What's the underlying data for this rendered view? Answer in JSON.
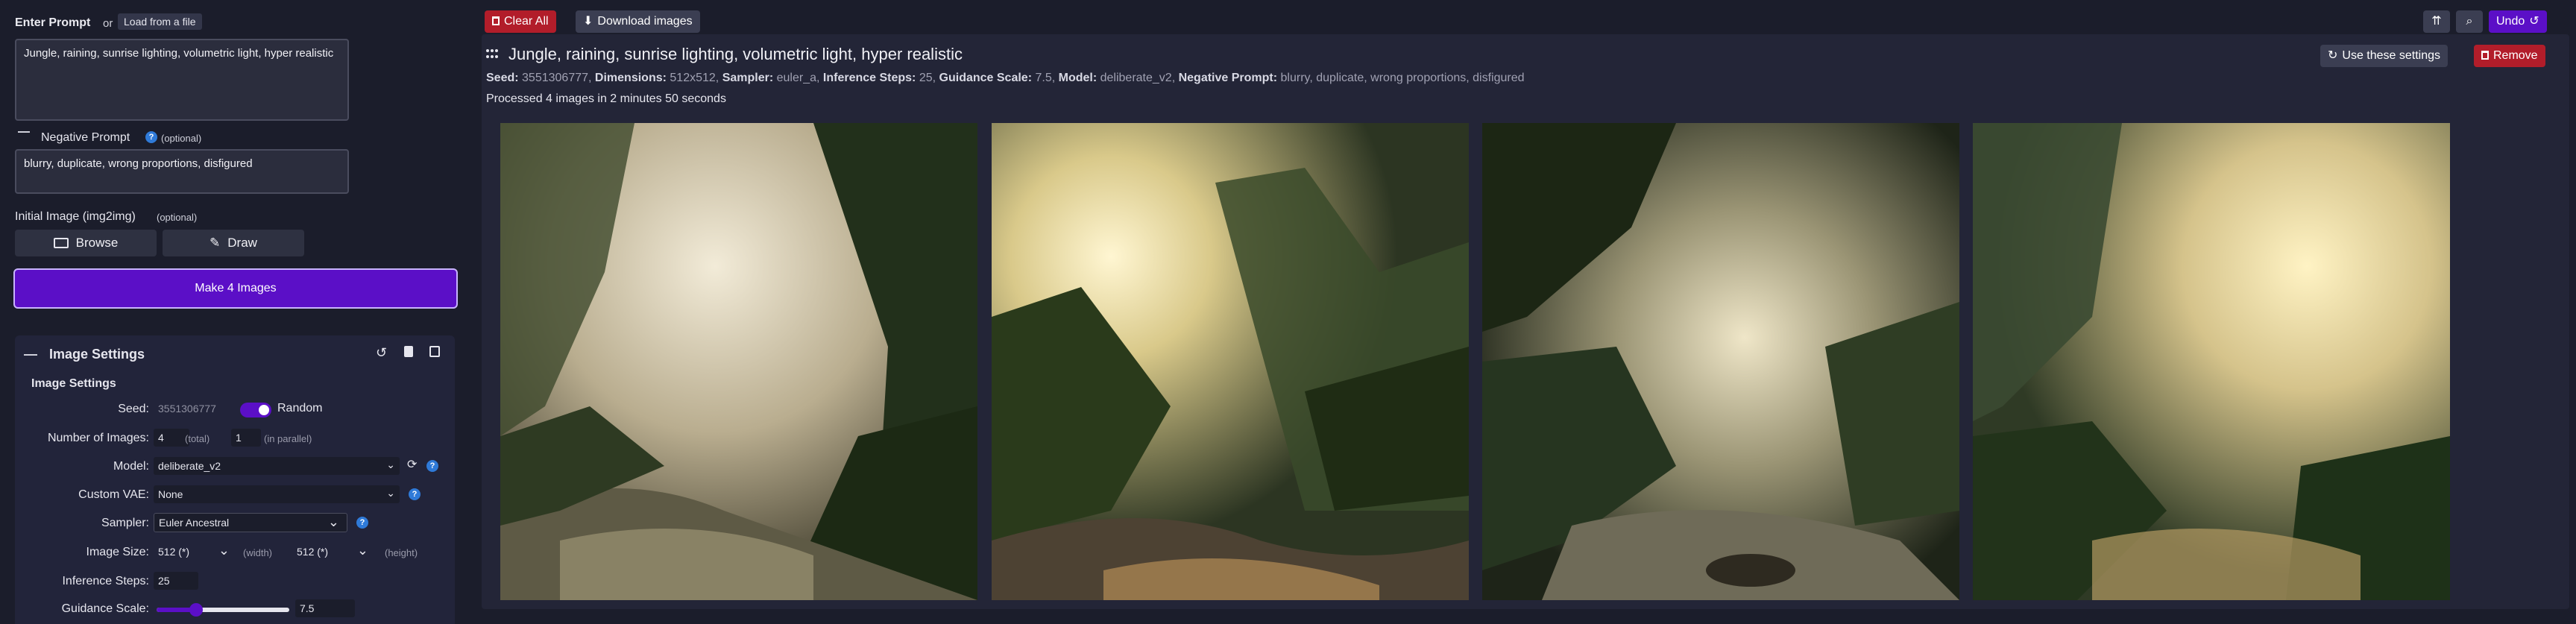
{
  "prompt": {
    "label": "Enter Prompt",
    "or": "or",
    "load_button": "Load from a file",
    "value": "Jungle, raining, sunrise lighting, volumetric light, hyper realistic"
  },
  "negative": {
    "label": "Negative Prompt",
    "optional": "(optional)",
    "value": "blurry, duplicate, wrong proportions, disfigured"
  },
  "initial_image": {
    "label": "Initial Image (img2img)",
    "optional": "(optional)",
    "browse": "Browse",
    "draw": "Draw"
  },
  "make_button": "Make 4 Images",
  "settings": {
    "title": "Image Settings",
    "subtitle": "Image Settings",
    "seed_label": "Seed:",
    "seed_value": "3551306777",
    "random_label": "Random",
    "num_images_label": "Number of Images:",
    "num_total": "4",
    "total_hint": "(total)",
    "num_parallel": "1",
    "parallel_hint": "(in parallel)",
    "model_label": "Model:",
    "model_value": "deliberate_v2",
    "vae_label": "Custom VAE:",
    "vae_value": "None",
    "sampler_label": "Sampler:",
    "sampler_value": "Euler Ancestral",
    "size_label": "Image Size:",
    "width_value": "512 (*)",
    "width_hint": "(width)",
    "height_value": "512 (*)",
    "height_hint": "(height)",
    "steps_label": "Inference Steps:",
    "steps_value": "25",
    "guidance_label": "Guidance Scale:",
    "guidance_value": "7.5",
    "guidance_level": 0.3
  },
  "toolbar": {
    "clear_all": "Clear All",
    "download": "Download images",
    "undo": "Undo"
  },
  "result": {
    "title": "Jungle, raining, sunrise lighting, volumetric light, hyper realistic",
    "seed_k": "Seed:",
    "seed_v": "3551306777,",
    "dim_k": "Dimensions:",
    "dim_v": "512x512,",
    "sampler_k": "Sampler:",
    "sampler_v": "euler_a,",
    "steps_k": "Inference Steps:",
    "steps_v": "25,",
    "guidance_k": "Guidance Scale:",
    "guidance_v": "7.5,",
    "model_k": "Model:",
    "model_v": "deliberate_v2,",
    "neg_k": "Negative Prompt:",
    "neg_v": "blurry, duplicate, wrong proportions, disfigured",
    "processed": "Processed 4 images in 2 minutes 50 seconds",
    "use_settings": "Use these settings",
    "remove": "Remove"
  },
  "colors": {
    "accent": "#5b0fc7",
    "danger": "#b21d2a",
    "panel": "#22243a",
    "background": "#1b1d2b"
  }
}
